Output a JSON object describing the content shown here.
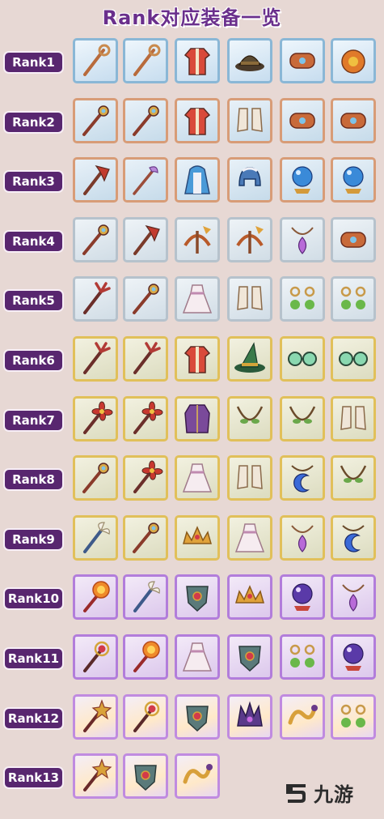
{
  "title": "Rank对应装备一览",
  "watermark_text": "九游",
  "ranks": [
    {
      "label": "Rank1",
      "items": [
        {
          "icon": "staff-icon",
          "quality": "blue"
        },
        {
          "icon": "staff-icon",
          "quality": "blue"
        },
        {
          "icon": "robe-icon",
          "quality": "blue"
        },
        {
          "icon": "hat-icon",
          "quality": "blue"
        },
        {
          "icon": "bracer-icon",
          "quality": "blue"
        },
        {
          "icon": "amulet-icon",
          "quality": "blue"
        }
      ]
    },
    {
      "label": "Rank2",
      "items": [
        {
          "icon": "scepter-icon",
          "quality": "copper"
        },
        {
          "icon": "scepter-icon",
          "quality": "copper"
        },
        {
          "icon": "robe-icon",
          "quality": "copper"
        },
        {
          "icon": "boots-icon",
          "quality": "copper"
        },
        {
          "icon": "bracer-icon",
          "quality": "copper"
        },
        {
          "icon": "bracer-icon",
          "quality": "copper"
        }
      ]
    },
    {
      "label": "Rank3",
      "items": [
        {
          "icon": "axe-icon",
          "quality": "copper"
        },
        {
          "icon": "wand-icon",
          "quality": "copper"
        },
        {
          "icon": "cloak-icon",
          "quality": "copper"
        },
        {
          "icon": "helmet-icon",
          "quality": "copper"
        },
        {
          "icon": "orb-icon",
          "quality": "copper"
        },
        {
          "icon": "orb-icon",
          "quality": "copper"
        }
      ]
    },
    {
      "label": "Rank4",
      "items": [
        {
          "icon": "scepter-icon",
          "quality": "silver"
        },
        {
          "icon": "axe-icon",
          "quality": "silver"
        },
        {
          "icon": "crossbow-icon",
          "quality": "silver"
        },
        {
          "icon": "crossbow-icon",
          "quality": "silver"
        },
        {
          "icon": "pendant-icon",
          "quality": "silver"
        },
        {
          "icon": "bracer-icon",
          "quality": "silver"
        }
      ]
    },
    {
      "label": "Rank5",
      "items": [
        {
          "icon": "trident-icon",
          "quality": "silver"
        },
        {
          "icon": "scepter-icon",
          "quality": "silver"
        },
        {
          "icon": "dress-icon",
          "quality": "silver"
        },
        {
          "icon": "boots-icon",
          "quality": "silver"
        },
        {
          "icon": "earring-icon",
          "quality": "silver"
        },
        {
          "icon": "earring-icon",
          "quality": "silver"
        }
      ]
    },
    {
      "label": "Rank6",
      "items": [
        {
          "icon": "trident-icon",
          "quality": "gold"
        },
        {
          "icon": "trident-icon",
          "quality": "gold"
        },
        {
          "icon": "robe-icon",
          "quality": "gold"
        },
        {
          "icon": "witch-hat-icon",
          "quality": "gold"
        },
        {
          "icon": "goggles-icon",
          "quality": "gold"
        },
        {
          "icon": "goggles-icon",
          "quality": "gold"
        }
      ]
    },
    {
      "label": "Rank7",
      "items": [
        {
          "icon": "flower-staff-icon",
          "quality": "gold"
        },
        {
          "icon": "flower-staff-icon",
          "quality": "gold"
        },
        {
          "icon": "coat-icon",
          "quality": "gold"
        },
        {
          "icon": "necklace-icon",
          "quality": "gold"
        },
        {
          "icon": "necklace-icon",
          "quality": "gold"
        },
        {
          "icon": "boots-icon",
          "quality": "gold"
        }
      ]
    },
    {
      "label": "Rank8",
      "items": [
        {
          "icon": "scepter-icon",
          "quality": "gold"
        },
        {
          "icon": "flower-staff-icon",
          "quality": "gold"
        },
        {
          "icon": "dress-icon",
          "quality": "gold"
        },
        {
          "icon": "boots-icon",
          "quality": "gold"
        },
        {
          "icon": "moon-amulet-icon",
          "quality": "gold"
        },
        {
          "icon": "necklace-icon",
          "quality": "gold"
        }
      ]
    },
    {
      "label": "Rank9",
      "items": [
        {
          "icon": "winged-staff-icon",
          "quality": "gold"
        },
        {
          "icon": "scepter-icon",
          "quality": "gold"
        },
        {
          "icon": "tiara-icon",
          "quality": "gold"
        },
        {
          "icon": "dress-icon",
          "quality": "gold"
        },
        {
          "icon": "pendant-icon",
          "quality": "gold"
        },
        {
          "icon": "moon-amulet-icon",
          "quality": "gold"
        }
      ]
    },
    {
      "label": "Rank10",
      "items": [
        {
          "icon": "sun-staff-icon",
          "quality": "purple"
        },
        {
          "icon": "winged-staff-icon",
          "quality": "purple"
        },
        {
          "icon": "armor-icon",
          "quality": "purple"
        },
        {
          "icon": "tiara-icon",
          "quality": "purple"
        },
        {
          "icon": "crystal-ball-icon",
          "quality": "purple"
        },
        {
          "icon": "pendant-icon",
          "quality": "purple"
        }
      ]
    },
    {
      "label": "Rank11",
      "items": [
        {
          "icon": "gem-staff-icon",
          "quality": "purple"
        },
        {
          "icon": "sun-staff-icon",
          "quality": "purple"
        },
        {
          "icon": "dress-icon",
          "quality": "purple"
        },
        {
          "icon": "armor-icon",
          "quality": "purple"
        },
        {
          "icon": "earring-icon",
          "quality": "purple"
        },
        {
          "icon": "crystal-ball-icon",
          "quality": "purple"
        }
      ]
    },
    {
      "label": "Rank12",
      "items": [
        {
          "icon": "star-staff-icon",
          "quality": "rainbow"
        },
        {
          "icon": "gem-staff-icon",
          "quality": "rainbow"
        },
        {
          "icon": "armor-icon",
          "quality": "rainbow"
        },
        {
          "icon": "crown-icon",
          "quality": "rainbow"
        },
        {
          "icon": "serpent-icon",
          "quality": "rainbow"
        },
        {
          "icon": "earring-icon",
          "quality": "rainbow"
        }
      ]
    },
    {
      "label": "Rank13",
      "items": [
        {
          "icon": "star-staff-icon",
          "quality": "rainbow"
        },
        {
          "icon": "armor-icon",
          "quality": "rainbow"
        },
        {
          "icon": "serpent-icon",
          "quality": "rainbow"
        }
      ]
    }
  ]
}
